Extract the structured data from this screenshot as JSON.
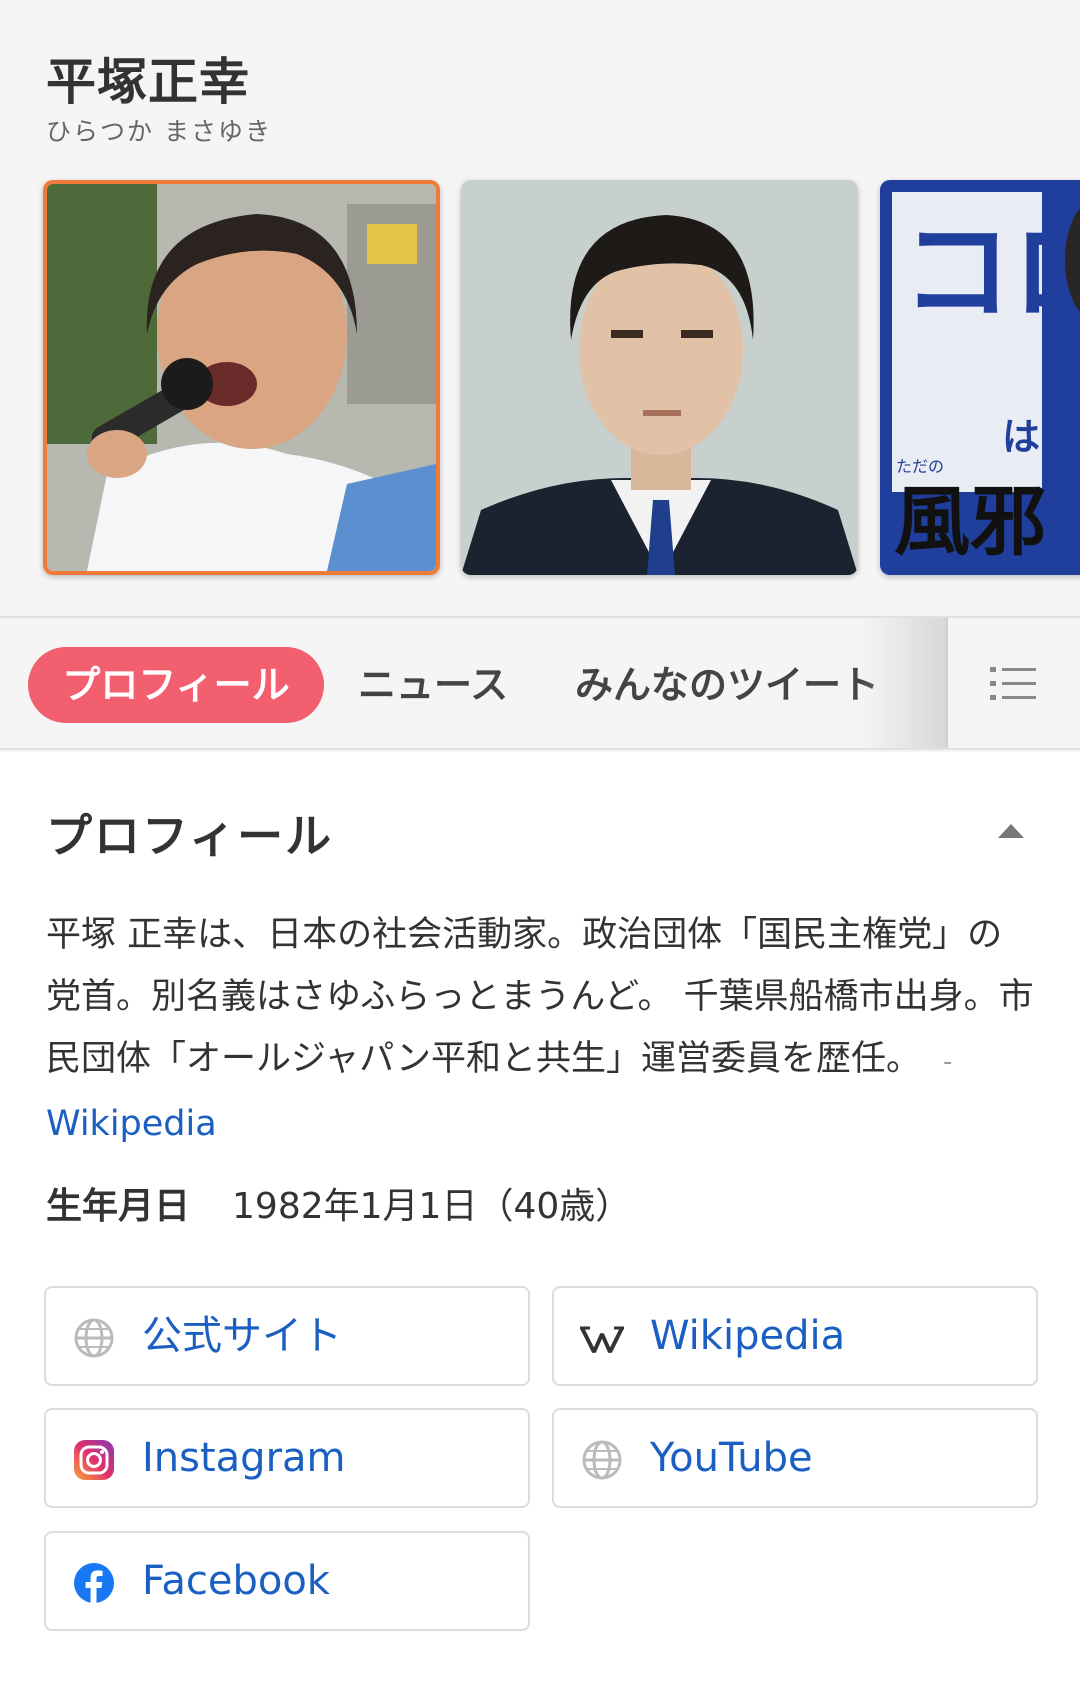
{
  "person": {
    "name": "平塚正幸",
    "reading": "ひらつか まさゆき"
  },
  "images": {
    "poster_text_main": "コロナ",
    "poster_text_small": "は",
    "poster_text_pre": "ただの",
    "poster_text_bottom": "風邪"
  },
  "tabs": {
    "profile": "プロフィール",
    "news": "ニュース",
    "tweets": "みんなのツイート"
  },
  "profile": {
    "title": "プロフィール",
    "description": "平塚 正幸は、日本の社会活動家。政治団体「国民主権党」の党首。別名義はさゆふらっとまうんど。 千葉県船橋市出身。市民団体「オールジャパン平和と共生」運営委員を歴任。",
    "source_sep": "-",
    "source_label": "Wikipedia",
    "birth_label": "生年月日",
    "birth_value": "1982年1月1日（40歳）"
  },
  "links": {
    "official": "公式サイト",
    "wikipedia": "Wikipedia",
    "instagram": "Instagram",
    "youtube": "YouTube",
    "facebook": "Facebook"
  },
  "colors": {
    "active_tab": "#f25f6e",
    "link": "#1a5fc1",
    "selected_border": "#f07a3a",
    "poster_blue": "#1f3a9c"
  }
}
